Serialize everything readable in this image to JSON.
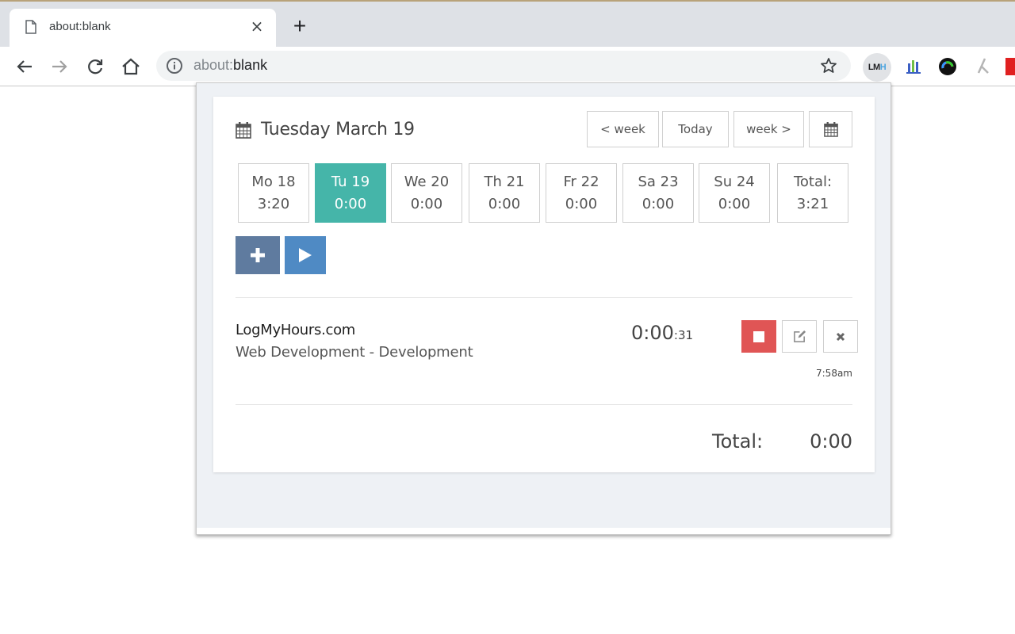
{
  "browser": {
    "tab_title": "about:blank",
    "new_tab_label": "+",
    "tab_close_label": "×",
    "url_scheme": "about:",
    "url_path": "blank",
    "extensions": [
      {
        "name": "LogMyHours",
        "label_main": "LM",
        "label_accent": "H"
      },
      {
        "name": "analytics-extension"
      },
      {
        "name": "color-extension"
      },
      {
        "name": "tool-extension"
      },
      {
        "name": "red-extension"
      }
    ]
  },
  "popup": {
    "date_title": "Tuesday March 19",
    "nav": {
      "prev_week": "< week",
      "today": "Today",
      "next_week": "week >"
    },
    "days": [
      {
        "label": "Mo 18",
        "hours": "3:20",
        "active": false
      },
      {
        "label": "Tu 19",
        "hours": "0:00",
        "active": true
      },
      {
        "label": "We 20",
        "hours": "0:00",
        "active": false
      },
      {
        "label": "Th 21",
        "hours": "0:00",
        "active": false
      },
      {
        "label": "Fr 22",
        "hours": "0:00",
        "active": false
      },
      {
        "label": "Sa 23",
        "hours": "0:00",
        "active": false
      },
      {
        "label": "Su 24",
        "hours": "0:00",
        "active": false
      }
    ],
    "week_total": {
      "label": "Total:",
      "hours": "3:21"
    },
    "entry": {
      "client": "LogMyHours.com",
      "project": "Web Development - Development",
      "timer_main": "0:00",
      "timer_seconds": ":31",
      "start_time": "7:58am"
    },
    "day_total": {
      "label": "Total:",
      "value": "0:00"
    },
    "colors": {
      "active_day": "#45b5a9",
      "add_button": "#5f7b9f",
      "play_button": "#4f8ac4",
      "stop_button": "#e05555"
    }
  }
}
